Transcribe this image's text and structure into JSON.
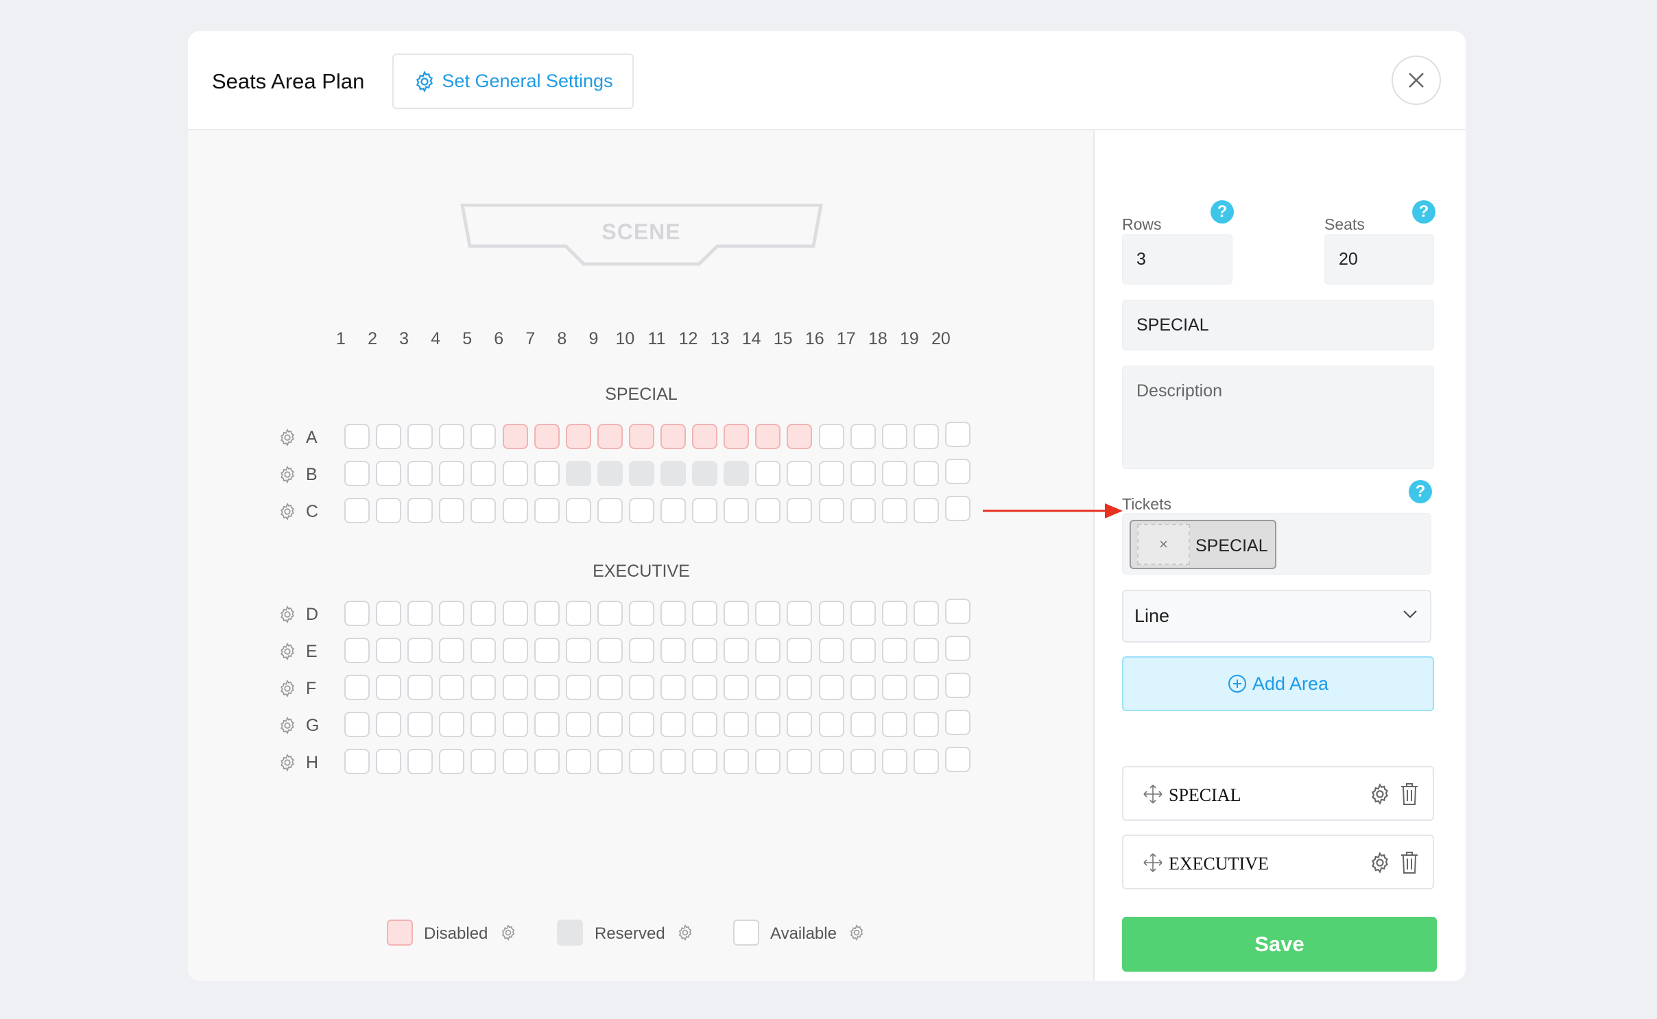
{
  "header": {
    "title": "Seats Area Plan",
    "settings_label": "Set General Settings"
  },
  "scene": {
    "label": "SCENE"
  },
  "columns": [
    "1",
    "2",
    "3",
    "4",
    "5",
    "6",
    "7",
    "8",
    "9",
    "10",
    "11",
    "12",
    "13",
    "14",
    "15",
    "16",
    "17",
    "18",
    "19",
    "20"
  ],
  "areas": [
    {
      "name": "SPECIAL",
      "rows": [
        "A",
        "B",
        "C"
      ]
    },
    {
      "name": "EXECUTIVE",
      "rows": [
        "D",
        "E",
        "F",
        "G",
        "H"
      ]
    }
  ],
  "seat_states": {
    "A": {
      "disabled": [
        6,
        7,
        8,
        9,
        10,
        11,
        12,
        13,
        14,
        15
      ]
    },
    "B": {
      "reserved": [
        8,
        9,
        10,
        11,
        12,
        13
      ]
    }
  },
  "legend": {
    "disabled": "Disabled",
    "reserved": "Reserved",
    "available": "Available"
  },
  "form": {
    "rows_label": "Rows",
    "rows_value": "3",
    "seats_label": "Seats",
    "seats_value": "20",
    "area_name": "SPECIAL",
    "description_placeholder": "Description",
    "tickets_label": "Tickets",
    "ticket_chip": "SPECIAL",
    "ticket_remove": "×",
    "shape_select": "Line",
    "add_area_label": "Add Area",
    "help": "?"
  },
  "area_list": [
    {
      "name": "SPECIAL"
    },
    {
      "name": "EXECUTIVE"
    }
  ],
  "save_label": "Save",
  "colors": {
    "accent": "#1e9be6",
    "save": "#52d273",
    "disabled_seat": "#fde0e0",
    "reserved_seat": "#e4e5e7",
    "annotation_arrow": "#e8311e"
  }
}
